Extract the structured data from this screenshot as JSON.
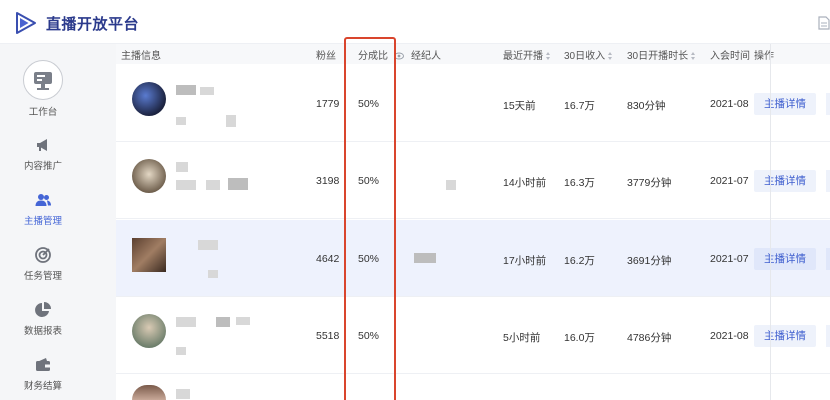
{
  "app": {
    "title": "直播开放平台"
  },
  "sidebar": {
    "items": [
      {
        "label": "工作台",
        "icon": "workbench-icon",
        "active": false
      },
      {
        "label": "内容推广",
        "icon": "megaphone-icon",
        "active": false
      },
      {
        "label": "主播管理",
        "icon": "users-icon",
        "active": true
      },
      {
        "label": "任务管理",
        "icon": "target-icon",
        "active": false
      },
      {
        "label": "数据报表",
        "icon": "pie-chart-icon",
        "active": false
      },
      {
        "label": "财务结算",
        "icon": "wallet-icon",
        "active": false
      }
    ]
  },
  "table": {
    "headers": {
      "streamer": "主播信息",
      "fans": "粉丝",
      "share": "分成比",
      "agent": "经纪人",
      "recent": "最近开播",
      "income": "30日收入",
      "duration": "30日开播时长",
      "joined": "入会时间",
      "action": "操作"
    },
    "rows": [
      {
        "fans": "1779",
        "share": "50%",
        "recent": "15天前",
        "income": "16.7万",
        "duration": "830分钟",
        "joined": "2021-08",
        "action": "主播详情"
      },
      {
        "fans": "3198",
        "share": "50%",
        "recent": "14小时前",
        "income": "16.3万",
        "duration": "3779分钟",
        "joined": "2021-07",
        "action": "主播详情"
      },
      {
        "fans": "4642",
        "share": "50%",
        "recent": "17小时前",
        "income": "16.2万",
        "duration": "3691分钟",
        "joined": "2021-07",
        "action": "主播详情"
      },
      {
        "fans": "5518",
        "share": "50%",
        "recent": "5小时前",
        "income": "16.0万",
        "duration": "4786分钟",
        "joined": "2021-08",
        "action": "主播详情"
      }
    ]
  },
  "colors": {
    "accent": "#4465d6",
    "annotation": "#d9452d",
    "highlight_row": "#eef2fd"
  }
}
